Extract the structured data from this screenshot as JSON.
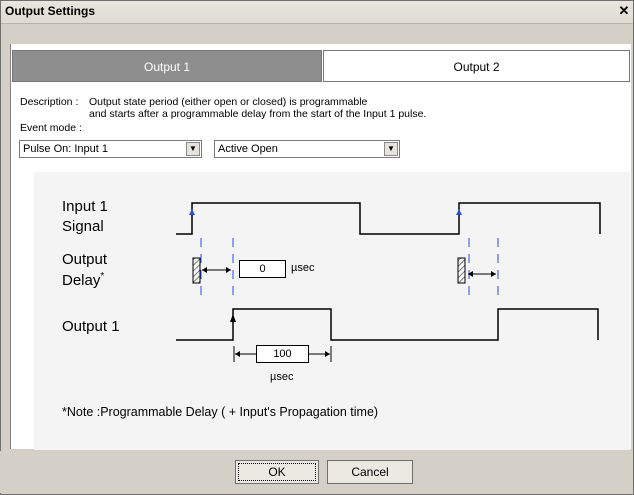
{
  "window": {
    "title": "Output Settings"
  },
  "tabs": [
    {
      "label": "Output 1",
      "selected": false
    },
    {
      "label": "Output 2",
      "selected": true
    }
  ],
  "description": {
    "label": "Description :",
    "line1": "Output state period (either open or closed) is programmable",
    "line2": "and starts after a programmable delay from the start of the Input 1 pulse."
  },
  "event_mode": {
    "label": "Event mode :",
    "trigger_value": "Pulse On: Input 1",
    "state_value": "Active Open"
  },
  "diagram": {
    "input1_label_line1": "Input 1",
    "input1_label_line2": "Signal",
    "output_delay_line1": "Output",
    "output_delay_line2": "Delay",
    "output_delay_asterisk": "*",
    "output1_label": "Output 1",
    "delay_value": "0",
    "delay_unit": "µsec",
    "width_value": "100",
    "width_unit": "µsec",
    "note": "*Note :Programmable Delay ( + Input's Propagation time)"
  },
  "buttons": {
    "ok": "OK",
    "cancel": "Cancel"
  },
  "colors": {
    "tab_selected_bg": "#ffffff",
    "tab_unselected_bg": "#8e8e8e",
    "marker": "#2a4fd6",
    "dialog_bg": "#d4d0c8"
  }
}
